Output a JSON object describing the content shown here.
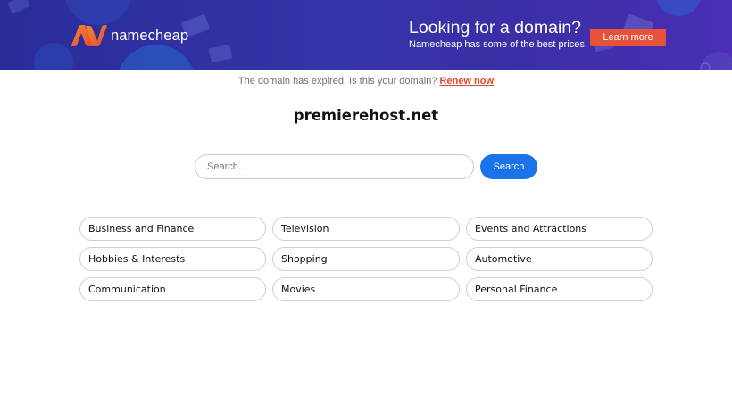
{
  "banner": {
    "brand": "namecheap",
    "logo_icon": "namecheap-logo-icon",
    "title": "Looking for a domain?",
    "subtitle": "Namecheap has some of the best prices.",
    "cta_label": "Learn more",
    "colors": {
      "background": "#3534a8",
      "cta": "#e8513a",
      "logo_orange": "#f26b3a"
    }
  },
  "notice": {
    "text": "The domain has expired. Is this your domain?",
    "link_label": "Renew now"
  },
  "domain": {
    "name": "premierehost.net"
  },
  "search": {
    "placeholder": "Search...",
    "value": "",
    "button_label": "Search",
    "accent": "#1a73e8"
  },
  "related_links": [
    "Business and Finance",
    "Television",
    "Events and Attractions",
    "Hobbies & Interests",
    "Shopping",
    "Automotive",
    "Communication",
    "Movies",
    "Personal Finance"
  ]
}
